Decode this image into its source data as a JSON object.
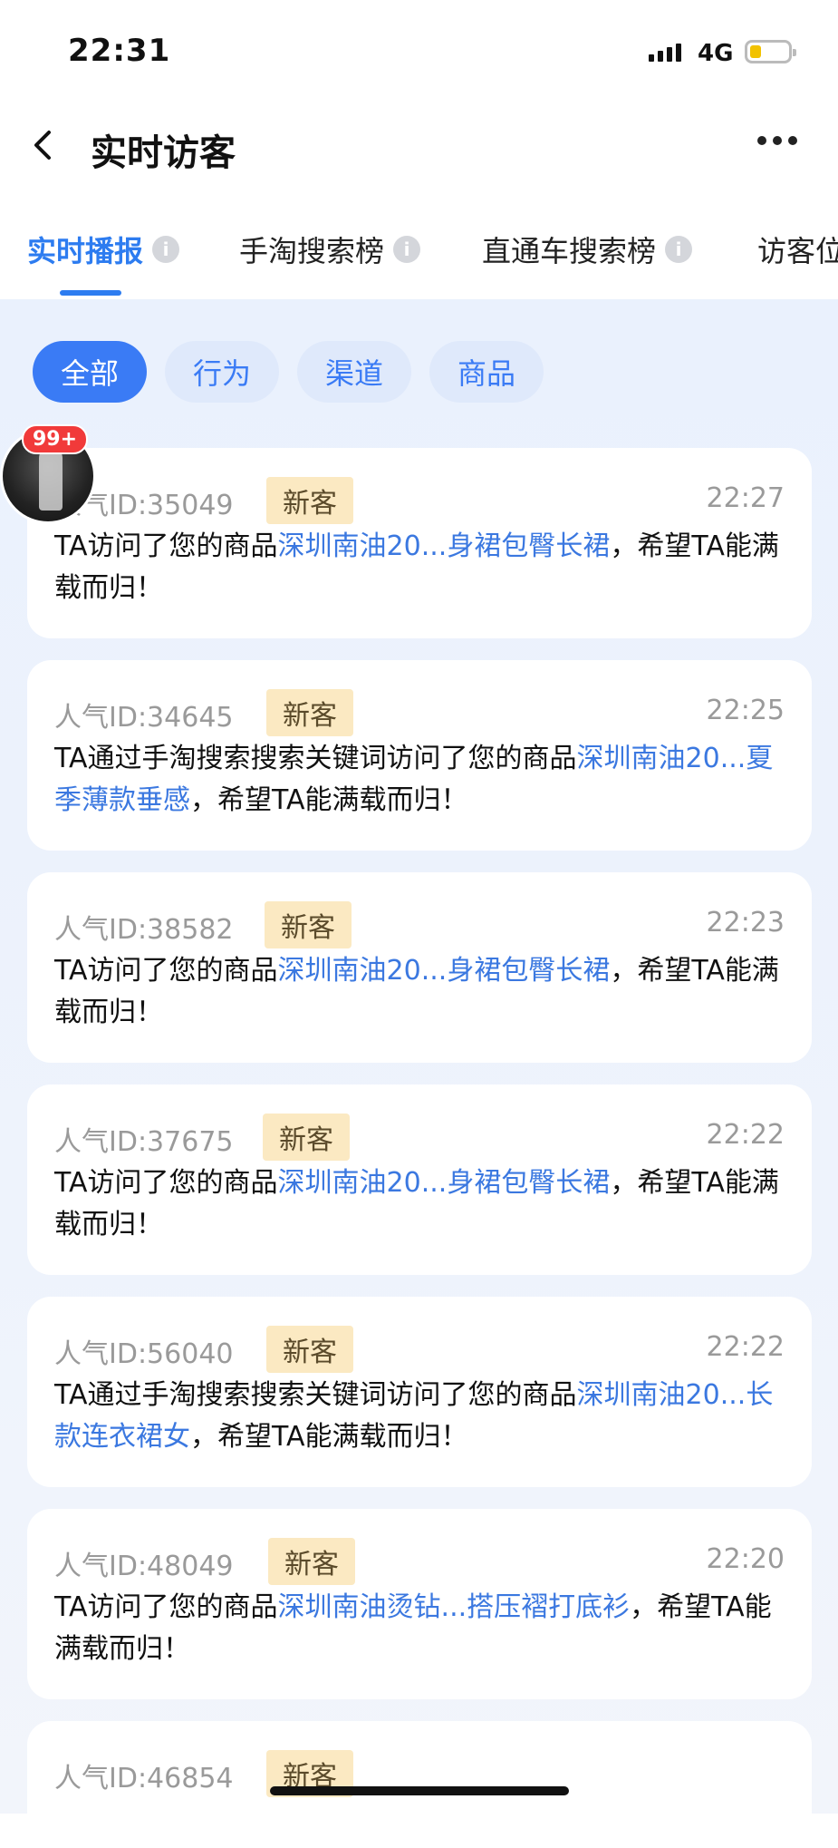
{
  "status_bar": {
    "time": "22:31",
    "network": "4G"
  },
  "nav": {
    "title": "实时访客"
  },
  "tabs": [
    {
      "label": "实时播报",
      "active": true
    },
    {
      "label": "手淘搜索榜",
      "active": false
    },
    {
      "label": "直通车搜索榜",
      "active": false
    },
    {
      "label": "访客位",
      "active": false
    }
  ],
  "info_glyph": "i",
  "filters": [
    {
      "label": "全部",
      "active": true
    },
    {
      "label": "行为",
      "active": false
    },
    {
      "label": "渠道",
      "active": false
    },
    {
      "label": "商品",
      "active": false
    }
  ],
  "floating_avatar": {
    "badge": "99+"
  },
  "colors": {
    "accent": "#2d7cf0",
    "link": "#3b78e0",
    "badge_bg": "#fbe9c2",
    "notification": "#f13a3a"
  },
  "visits": [
    {
      "uid": "人气ID:35049",
      "tag": "新客",
      "time": "22:27",
      "pre": "TA访问了您的商品",
      "product": "深圳南油20...身裙包臀长裙",
      "post": "，希望TA能满载而归！"
    },
    {
      "uid": "人气ID:34645",
      "tag": "新客",
      "time": "22:25",
      "pre": "TA通过手淘搜索搜索关键词访问了您的商品",
      "product": "深圳南油20...夏季薄款垂感",
      "post": "，希望TA能满载而归！"
    },
    {
      "uid": "人气ID:38582",
      "tag": "新客",
      "time": "22:23",
      "pre": "TA访问了您的商品",
      "product": "深圳南油20...身裙包臀长裙",
      "post": "，希望TA能满载而归！"
    },
    {
      "uid": "人气ID:37675",
      "tag": "新客",
      "time": "22:22",
      "pre": "TA访问了您的商品",
      "product": "深圳南油20...身裙包臀长裙",
      "post": "，希望TA能满载而归！"
    },
    {
      "uid": "人气ID:56040",
      "tag": "新客",
      "time": "22:22",
      "pre": "TA通过手淘搜索搜索关键词访问了您的商品",
      "product": "深圳南油20...长款连衣裙女",
      "post": "，希望TA能满载而归！"
    },
    {
      "uid": "人气ID:48049",
      "tag": "新客",
      "time": "22:20",
      "pre": "TA访问了您的商品",
      "product": "深圳南油烫钻...搭压褶打底衫",
      "post": "，希望TA能满载而归！"
    },
    {
      "uid": "人气ID:46854",
      "tag": "新客",
      "time": "",
      "pre": "",
      "product": "",
      "post": ""
    }
  ]
}
